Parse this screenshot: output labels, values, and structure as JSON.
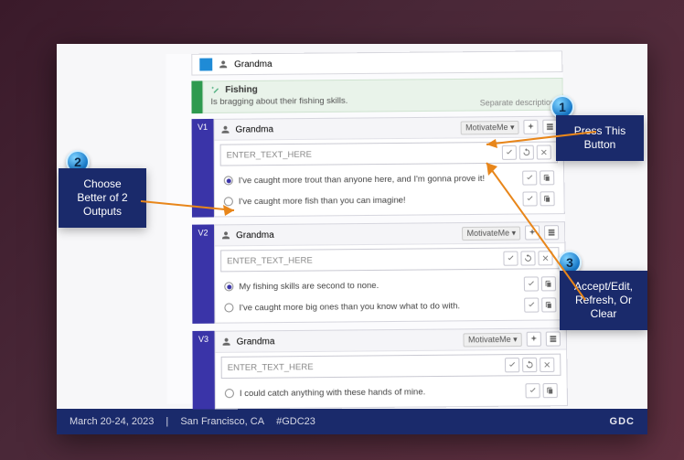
{
  "footer": {
    "date": "March 20-24, 2023",
    "location": "San Francisco, CA",
    "hashtag": "#GDC23",
    "brand": "GDC"
  },
  "callouts": {
    "c1": "Press This Button",
    "c2": "Choose Better of 2 Outputs",
    "c3": "Accept/Edit, Refresh, Or Clear",
    "n1": "1",
    "n2": "2",
    "n3": "3"
  },
  "character": {
    "name": "Grandma"
  },
  "action": {
    "title": "Fishing",
    "desc": "Is bragging about their fishing skills.",
    "aside": "Separate description"
  },
  "motivate_label": "MotivateMe ▾",
  "generate_tip": "[G]",
  "variants": [
    {
      "tag": "V1",
      "speaker": "Grandma",
      "placeholder": "ENTER_TEXT_HERE",
      "options": [
        {
          "text": "I've caught more trout than anyone here, and I'm gonna prove it!",
          "selected": true
        },
        {
          "text": "I've caught more fish than you can imagine!",
          "selected": false
        }
      ]
    },
    {
      "tag": "V2",
      "speaker": "Grandma",
      "placeholder": "ENTER_TEXT_HERE",
      "options": [
        {
          "text": "My fishing skills are second to none.",
          "selected": true
        },
        {
          "text": "I've caught more big ones than you know what to do with.",
          "selected": false
        }
      ]
    },
    {
      "tag": "V3",
      "speaker": "Grandma",
      "placeholder": "ENTER_TEXT_HERE",
      "options": [
        {
          "text": "I could catch anything with these hands of mine.",
          "selected": false
        }
      ]
    }
  ]
}
